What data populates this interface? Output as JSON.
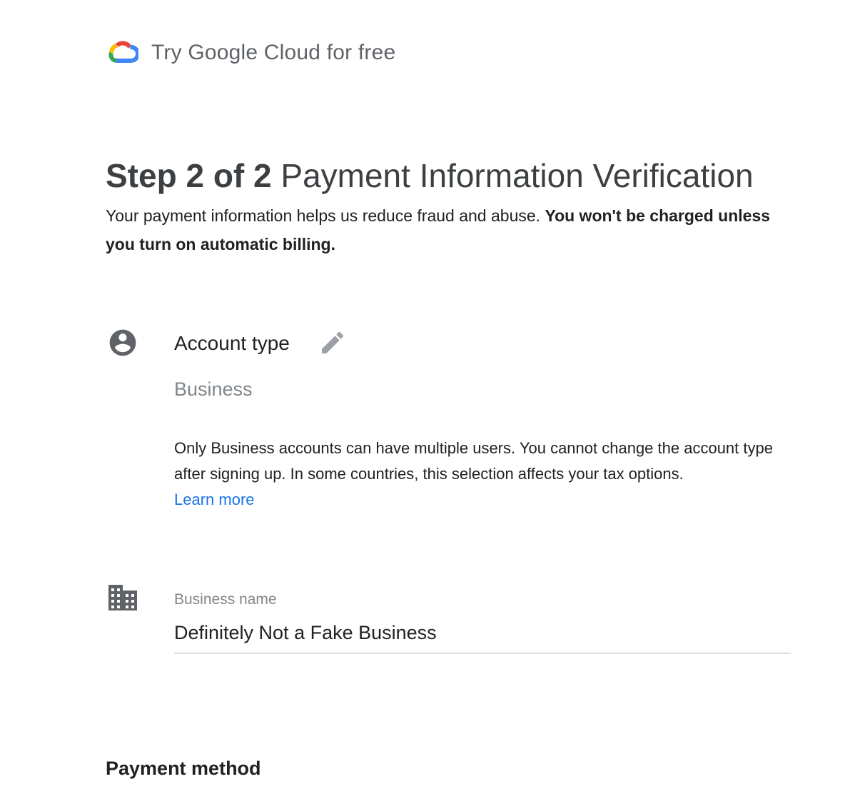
{
  "header": {
    "logo_icon": "google-cloud-logo",
    "title": "Try Google Cloud for free"
  },
  "step": {
    "label": "Step 2 of 2",
    "title": "Payment Information Verification"
  },
  "intro": {
    "text": "Your payment information helps us reduce fraud and abuse.",
    "bold_text": "You won't be charged unless you turn on automatic billing."
  },
  "account_type": {
    "icon": "account-circle-icon",
    "title": "Account type",
    "edit_icon": "pencil-icon",
    "value": "Business",
    "description": "Only Business accounts can have multiple users. You cannot change the account type after signing up. In some countries, this selection affects your tax options.",
    "learn_more": "Learn more"
  },
  "business": {
    "icon": "building-icon",
    "label": "Business name",
    "value": "Definitely Not a Fake Business"
  },
  "payment": {
    "heading": "Payment method"
  },
  "colors": {
    "link": "#1a73e8",
    "muted": "#80868b",
    "icon": "#5f6368",
    "underline": "#dadce0"
  }
}
